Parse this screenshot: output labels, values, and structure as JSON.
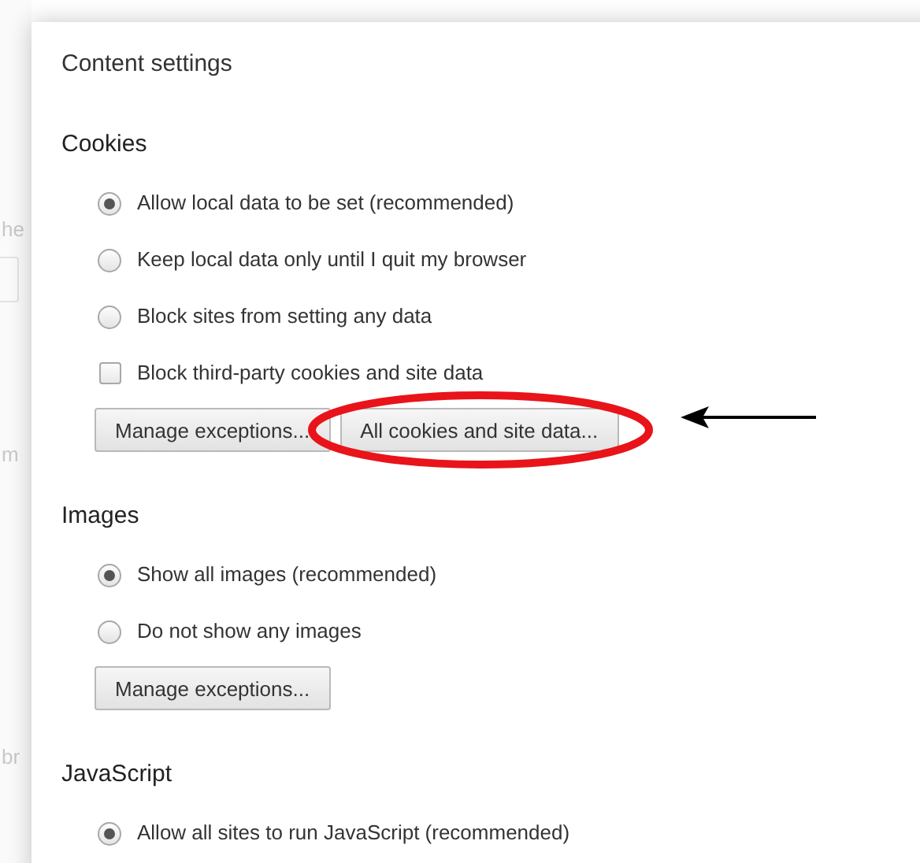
{
  "background_page": {
    "fragments": [
      "he",
      "m",
      "br"
    ]
  },
  "dialog": {
    "title": "Content settings",
    "sections": [
      {
        "title": "Cookies",
        "options": [
          {
            "kind": "radio",
            "label": "Allow local data to be set (recommended)",
            "selected": true
          },
          {
            "kind": "radio",
            "label": "Keep local data only until I quit my browser",
            "selected": false
          },
          {
            "kind": "radio",
            "label": "Block sites from setting any data",
            "selected": false
          },
          {
            "kind": "checkbox",
            "label": "Block third-party cookies and site data",
            "checked": false
          }
        ],
        "buttons": [
          {
            "label": "Manage exceptions...",
            "circled": false
          },
          {
            "label": "All cookies and site data...",
            "circled": true
          }
        ]
      },
      {
        "title": "Images",
        "options": [
          {
            "kind": "radio",
            "label": "Show all images (recommended)",
            "selected": true
          },
          {
            "kind": "radio",
            "label": "Do not show any images",
            "selected": false
          }
        ],
        "buttons": [
          {
            "label": "Manage exceptions...",
            "circled": false
          }
        ]
      },
      {
        "title": "JavaScript",
        "options": [
          {
            "kind": "radio",
            "label": "Allow all sites to run JavaScript (recommended)",
            "selected": true
          }
        ]
      }
    ]
  }
}
